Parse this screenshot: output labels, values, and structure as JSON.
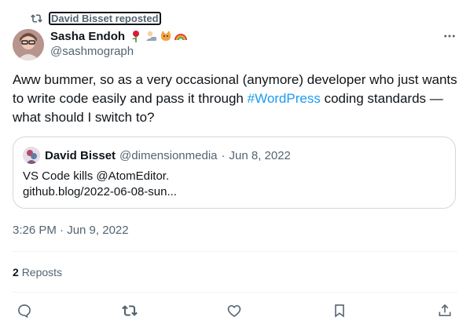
{
  "repost": {
    "label": "David Bisset reposted"
  },
  "author": {
    "name": "Sasha Endoh",
    "handle": "@sashmograph",
    "emojis": [
      "rose-emoji",
      "technologist-emoji",
      "cat-emoji",
      "rainbow-emoji"
    ]
  },
  "tweet": {
    "text_before": "Aww bummer, so as a very occasional (anymore) developer who just wants to write code easily and pass it through ",
    "hashtag": "#WordPress",
    "text_after": " coding standards — what should I switch to?"
  },
  "quote": {
    "name": "David Bisset",
    "handle": "@dimensionmedia",
    "separator": "·",
    "date": "Jun 8, 2022",
    "line1": "VS Code kills @AtomEditor.",
    "line2": "github.blog/2022-06-08-sun..."
  },
  "timestamp": "3:26 PM · Jun 9, 2022",
  "stats": {
    "reposts_count": "2",
    "reposts_label": "Reposts"
  },
  "actions": [
    "reply-icon",
    "repost-icon",
    "like-icon",
    "bookmark-icon",
    "share-icon"
  ],
  "colors": {
    "accent": "#1d9bf0",
    "secondary_text": "#536471",
    "border": "#cfd9de"
  }
}
